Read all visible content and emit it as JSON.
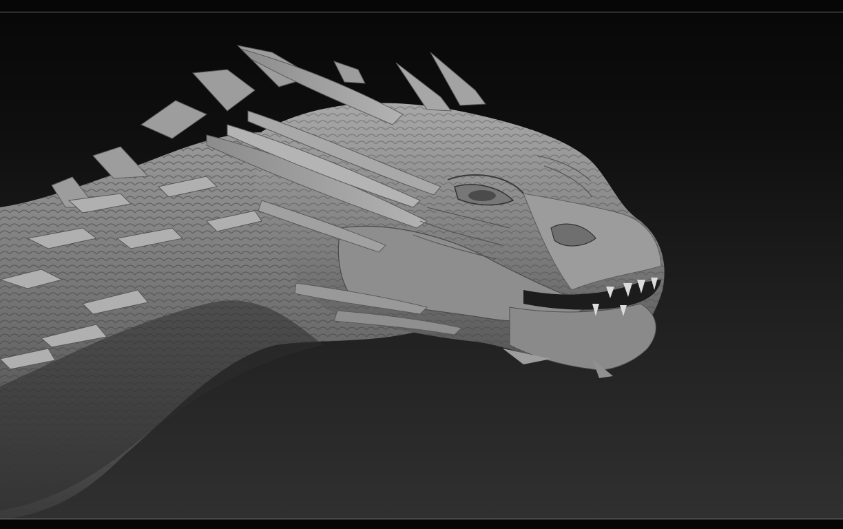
{
  "viewport": {
    "subject": "dragon-head-sculpt",
    "material": "matcap-gray",
    "background_top": "#080808",
    "background_bottom": "#303030",
    "frame_line_color": "#8a8a8a"
  }
}
